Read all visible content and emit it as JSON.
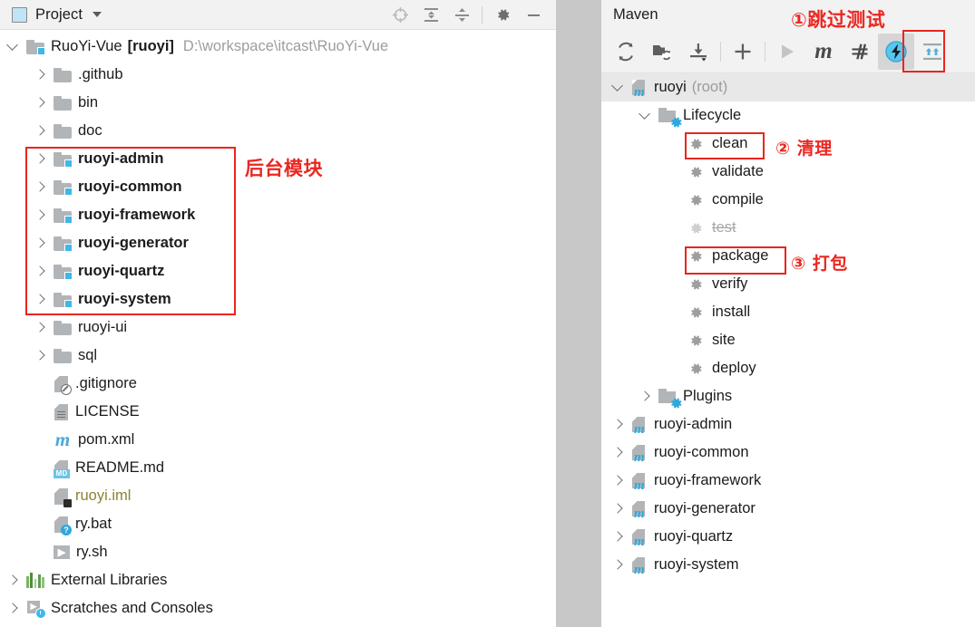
{
  "project_panel": {
    "title": "Project",
    "header_icons": [
      {
        "name": "locate-target-icon"
      },
      {
        "name": "expand-all-icon"
      },
      {
        "name": "collapse-all-icon"
      },
      {
        "name": "settings-gear-icon"
      },
      {
        "name": "minimize-icon"
      }
    ],
    "root": {
      "label": "RuoYi-Vue",
      "module_name": "[ruoyi]",
      "path": "D:\\workspace\\itcast\\RuoYi-Vue"
    },
    "tree": [
      {
        "label": ".github",
        "icon": "folder-icon",
        "arrow": "right",
        "indent": 1,
        "style": "normal"
      },
      {
        "label": "bin",
        "icon": "folder-icon",
        "arrow": "right",
        "indent": 1,
        "style": "normal"
      },
      {
        "label": "doc",
        "icon": "folder-icon",
        "arrow": "right",
        "indent": 1,
        "style": "normal"
      },
      {
        "label": "ruoyi-admin",
        "icon": "module-folder-icon",
        "arrow": "right",
        "indent": 1,
        "style": "bold"
      },
      {
        "label": "ruoyi-common",
        "icon": "module-folder-icon",
        "arrow": "right",
        "indent": 1,
        "style": "bold"
      },
      {
        "label": "ruoyi-framework",
        "icon": "module-folder-icon",
        "arrow": "right",
        "indent": 1,
        "style": "bold"
      },
      {
        "label": "ruoyi-generator",
        "icon": "module-folder-icon",
        "arrow": "right",
        "indent": 1,
        "style": "bold"
      },
      {
        "label": "ruoyi-quartz",
        "icon": "module-folder-icon",
        "arrow": "right",
        "indent": 1,
        "style": "bold"
      },
      {
        "label": "ruoyi-system",
        "icon": "module-folder-icon",
        "arrow": "right",
        "indent": 1,
        "style": "bold"
      },
      {
        "label": "ruoyi-ui",
        "icon": "folder-icon",
        "arrow": "right",
        "indent": 1,
        "style": "normal"
      },
      {
        "label": "sql",
        "icon": "folder-icon",
        "arrow": "right",
        "indent": 1,
        "style": "normal"
      },
      {
        "label": ".gitignore",
        "icon": "gitignore-file-icon",
        "arrow": "none",
        "indent": 1,
        "style": "normal"
      },
      {
        "label": "LICENSE",
        "icon": "text-file-icon",
        "arrow": "none",
        "indent": 1,
        "style": "normal"
      },
      {
        "label": "pom.xml",
        "icon": "maven-pom-icon",
        "arrow": "none",
        "indent": 1,
        "style": "normal"
      },
      {
        "label": "README.md",
        "icon": "markdown-file-icon",
        "arrow": "none",
        "indent": 1,
        "style": "normal"
      },
      {
        "label": "ruoyi.iml",
        "icon": "iml-file-icon",
        "arrow": "none",
        "indent": 1,
        "style": "olive"
      },
      {
        "label": "ry.bat",
        "icon": "bat-file-icon",
        "arrow": "none",
        "indent": 1,
        "style": "normal"
      },
      {
        "label": "ry.sh",
        "icon": "sh-file-icon",
        "arrow": "none",
        "indent": 1,
        "style": "normal"
      },
      {
        "label": "External Libraries",
        "icon": "libraries-icon",
        "arrow": "right",
        "indent": 0,
        "style": "normal"
      },
      {
        "label": "Scratches and Consoles",
        "icon": "scratches-icon",
        "arrow": "right",
        "indent": 0,
        "style": "normal"
      }
    ]
  },
  "maven_panel": {
    "title": "Maven",
    "toolbar": [
      {
        "name": "reload-projects-icon",
        "label": "Reload All Maven Projects"
      },
      {
        "name": "add-maven-project-icon",
        "label": "Add Maven Projects"
      },
      {
        "name": "download-sources-icon",
        "label": "Download Sources and Documentation"
      },
      {
        "name": "plus-icon",
        "label": "Add"
      },
      {
        "name": "run-icon",
        "label": "Run"
      },
      {
        "name": "maven-m-icon",
        "label": "Execute Maven Goal"
      },
      {
        "name": "toggle-offline-icon",
        "label": "Toggle Offline Mode"
      },
      {
        "name": "skip-tests-icon",
        "label": "Skip Tests"
      },
      {
        "name": "expand-collapse-icon",
        "label": "Collapse All"
      }
    ],
    "tree": {
      "root_label": "ruoyi",
      "root_suffix": "(root)",
      "lifecycle_label": "Lifecycle",
      "phases": [
        {
          "label": "clean",
          "disabled": false
        },
        {
          "label": "validate",
          "disabled": false
        },
        {
          "label": "compile",
          "disabled": false
        },
        {
          "label": "test",
          "disabled": true
        },
        {
          "label": "package",
          "disabled": false
        },
        {
          "label": "verify",
          "disabled": false
        },
        {
          "label": "install",
          "disabled": false
        },
        {
          "label": "site",
          "disabled": false
        },
        {
          "label": "deploy",
          "disabled": false
        }
      ],
      "plugins_label": "Plugins",
      "modules": [
        {
          "label": "ruoyi-admin"
        },
        {
          "label": "ruoyi-common"
        },
        {
          "label": "ruoyi-framework"
        },
        {
          "label": "ruoyi-generator"
        },
        {
          "label": "ruoyi-quartz"
        },
        {
          "label": "ruoyi-system"
        }
      ]
    }
  },
  "annotations": {
    "backend_modules": "后台模块",
    "skip_tests": "①跳过测试",
    "clean": "② 清理",
    "package": "③ 打包",
    "color": "#ec2620"
  }
}
